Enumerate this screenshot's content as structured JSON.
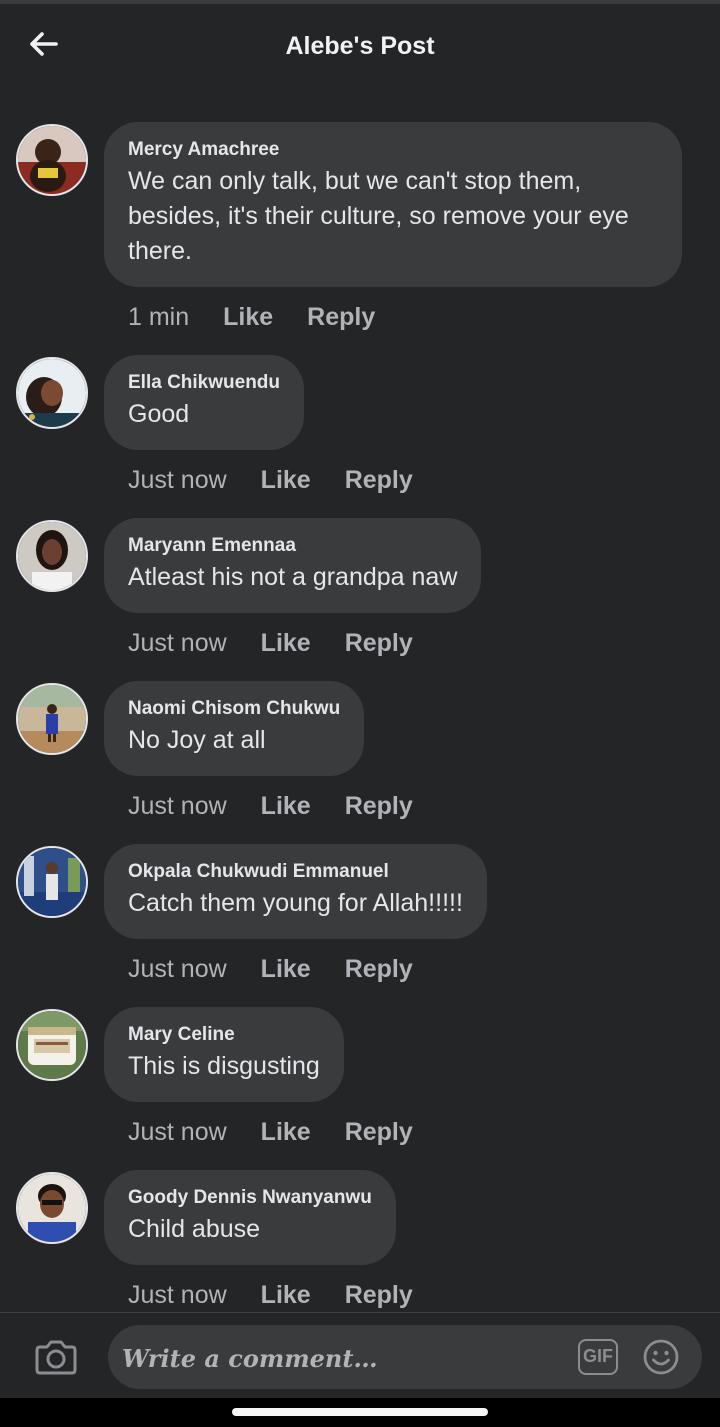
{
  "header": {
    "title": "Alebe's Post"
  },
  "comments": [
    {
      "author": "Mercy Amachree",
      "text": "We can only talk, but we can't stop them, besides, it's their culture, so remove your eye there.",
      "time": "1 min",
      "like": "Like",
      "reply": "Reply"
    },
    {
      "author": "Ella Chikwuendu",
      "text": "Good",
      "time": "Just now",
      "like": "Like",
      "reply": "Reply"
    },
    {
      "author": "Maryann Emennaa",
      "text": "Atleast his not a grandpa naw",
      "time": "Just now",
      "like": "Like",
      "reply": "Reply"
    },
    {
      "author": "Naomi Chisom Chukwu",
      "text": "No Joy at all",
      "time": "Just now",
      "like": "Like",
      "reply": "Reply"
    },
    {
      "author": "Okpala Chukwudi Emmanuel",
      "text": "Catch them young for Allah!!!!!",
      "time": "Just now",
      "like": "Like",
      "reply": "Reply"
    },
    {
      "author": "Mary Celine",
      "text": "This is disgusting",
      "time": "Just now",
      "like": "Like",
      "reply": "Reply"
    },
    {
      "author": "Goody Dennis Nwanyanwu",
      "text": "Child abuse",
      "time": "Just now",
      "like": "Like",
      "reply": "Reply"
    }
  ],
  "composer": {
    "placeholder": "Write a comment…",
    "gif_label": "GIF"
  }
}
